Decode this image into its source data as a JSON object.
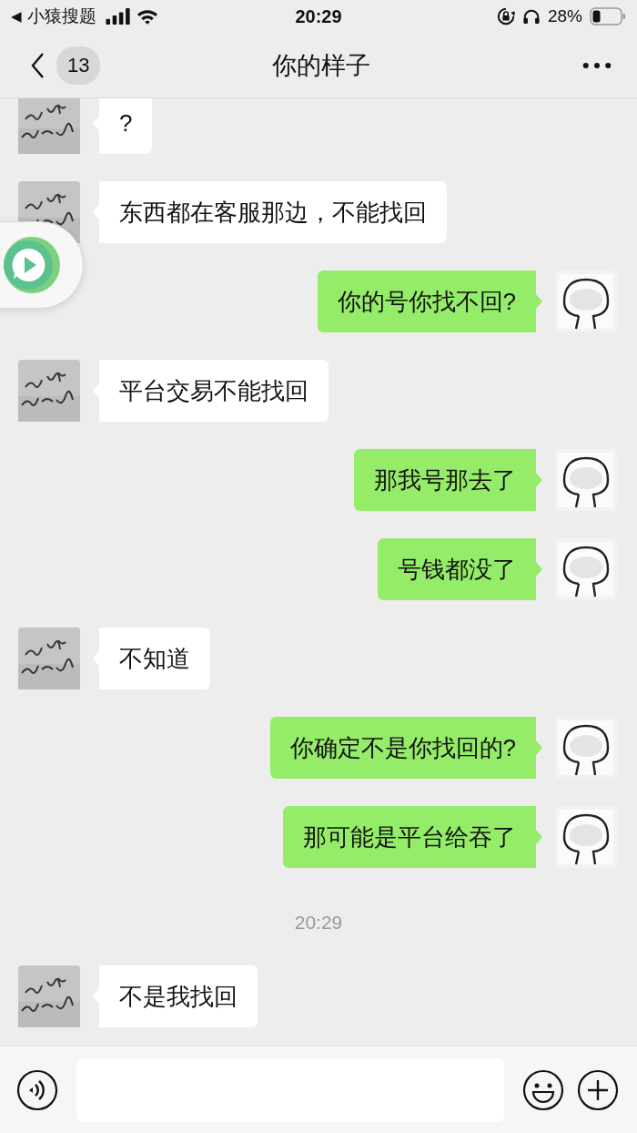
{
  "status_bar": {
    "back_arrow": "◀",
    "app": "小猿搜题",
    "time": "20:29",
    "battery_percent": "28%"
  },
  "nav": {
    "back_count": "13",
    "title": "你的样子"
  },
  "messages": [
    {
      "kind": "message",
      "outgoing": false,
      "text": "?"
    },
    {
      "kind": "message",
      "outgoing": false,
      "text": "东西都在客服那边，不能找回"
    },
    {
      "kind": "message",
      "outgoing": true,
      "text": "你的号你找不回?"
    },
    {
      "kind": "message",
      "outgoing": false,
      "text": "平台交易不能找回"
    },
    {
      "kind": "message",
      "outgoing": true,
      "text": "那我号那去了"
    },
    {
      "kind": "message",
      "outgoing": true,
      "text": "号钱都没了"
    },
    {
      "kind": "message",
      "outgoing": false,
      "text": "不知道"
    },
    {
      "kind": "message",
      "outgoing": true,
      "text": "你确定不是你找回的?"
    },
    {
      "kind": "message",
      "outgoing": true,
      "text": "那可能是平台给吞了"
    },
    {
      "kind": "time",
      "text": "20:29"
    },
    {
      "kind": "message",
      "outgoing": false,
      "text": "不是我找回"
    }
  ]
}
